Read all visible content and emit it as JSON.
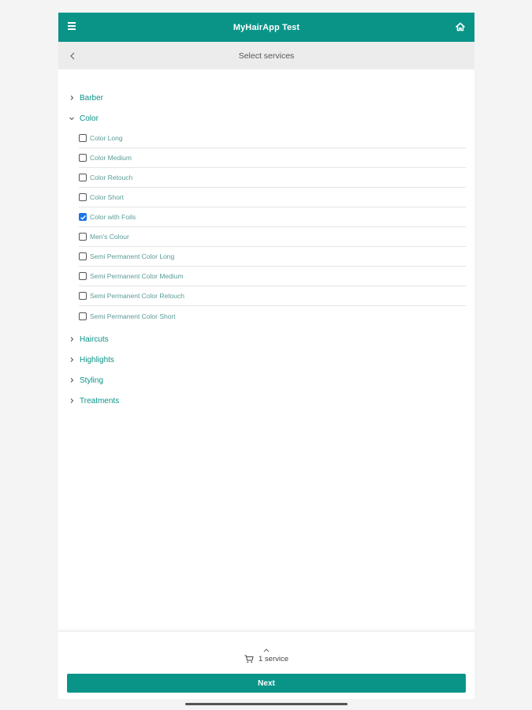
{
  "header": {
    "title": "MyHairApp Test",
    "menu_icon": "hamburger-menu-icon",
    "home_icon": "home-icon",
    "color": "#0a9488"
  },
  "subheader": {
    "title": "Select services",
    "back_icon": "chevron-left-icon"
  },
  "categories_before": [
    {
      "label": "Barber",
      "expanded": false
    }
  ],
  "expanded_category": {
    "label": "Color",
    "expanded": true,
    "services": [
      {
        "label": "Color Long",
        "checked": false
      },
      {
        "label": "Color Medium",
        "checked": false
      },
      {
        "label": "Color Retouch",
        "checked": false
      },
      {
        "label": "Color Short",
        "checked": false
      },
      {
        "label": "Color with Foils",
        "checked": true
      },
      {
        "label": "Men's Colour",
        "checked": false
      },
      {
        "label": "Semi Permanent Color Long",
        "checked": false
      },
      {
        "label": "Semi Permanent Color Medium",
        "checked": false
      },
      {
        "label": "Semi Permanent Color Retouch",
        "checked": false
      },
      {
        "label": "Semi Permanent Color Short",
        "checked": false
      }
    ]
  },
  "categories_after": [
    {
      "label": "Haircuts",
      "expanded": false
    },
    {
      "label": "Highlights",
      "expanded": false
    },
    {
      "label": "Styling",
      "expanded": false
    },
    {
      "label": "Treatments",
      "expanded": false
    }
  ],
  "footer": {
    "cart_icon": "cart-icon",
    "expand_icon": "chevron-up-icon",
    "cart_summary": "1 service",
    "next_label": "Next"
  }
}
